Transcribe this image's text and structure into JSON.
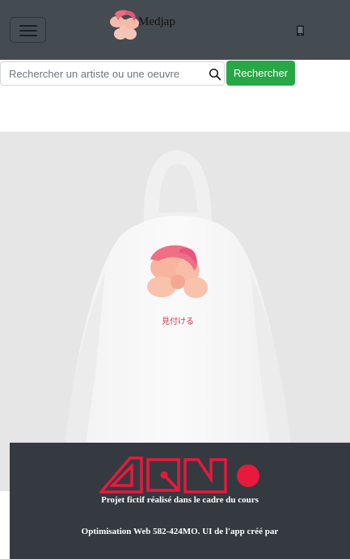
{
  "navbar": {
    "brand_name": "Medjap",
    "menu_icon": "hamburger-menu-icon",
    "phone_icon": "mobile-phone-icon",
    "background": "#444c52"
  },
  "search": {
    "placeholder": "Rechercher un artiste ou une oeuvre",
    "value": "",
    "button_label": "Rechercher",
    "button_color": "#28a745",
    "icon": "search-icon"
  },
  "product": {
    "description": "",
    "print_text": "見付ける"
  },
  "footer": {
    "logo_text": "AQM",
    "logo_color": "#e8193d",
    "line1": "Projet fictif réalisé dans le cadre du cours",
    "line2": "Optimisation Web 582-424MO. UI de l'app créé par",
    "background": "#343a40"
  }
}
